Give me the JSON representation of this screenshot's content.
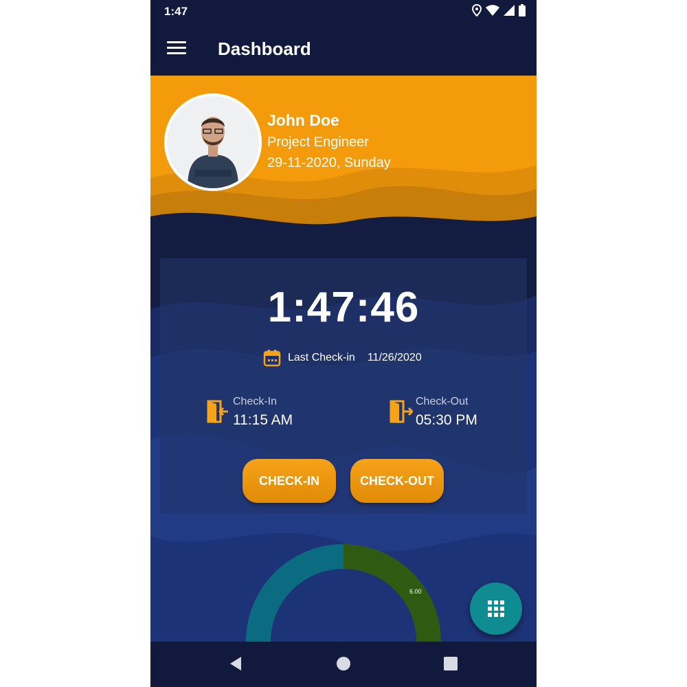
{
  "status_bar": {
    "time": "1:47"
  },
  "app_bar": {
    "title": "Dashboard"
  },
  "profile": {
    "name": "John Doe",
    "role": "Project Engineer",
    "date": "29-11-2020, Sunday"
  },
  "attendance": {
    "clock": "1:47:46",
    "last_checkin_label": "Last Check-in",
    "last_checkin_date": "11/26/2020",
    "checkin_label": "Check-In",
    "checkin_time": "11:15 AM",
    "checkout_label": "Check-Out",
    "checkout_time": "05:30 PM",
    "checkin_button": "CHECK-IN",
    "checkout_button": "CHECK-OUT"
  },
  "gauge": {
    "value_label": "6.00"
  },
  "colors": {
    "accent": "#f5a31a",
    "background": "#131d42",
    "fab": "#0e8c92",
    "gauge_teal": "#0b6b80",
    "gauge_green": "#2e5a12"
  },
  "icons": {
    "menu": "menu-icon",
    "calendar": "calendar-icon",
    "checkin": "door-enter-icon",
    "checkout": "door-exit-icon",
    "fab": "grid-icon",
    "nav": [
      "back-icon",
      "home-icon",
      "recents-icon"
    ]
  }
}
